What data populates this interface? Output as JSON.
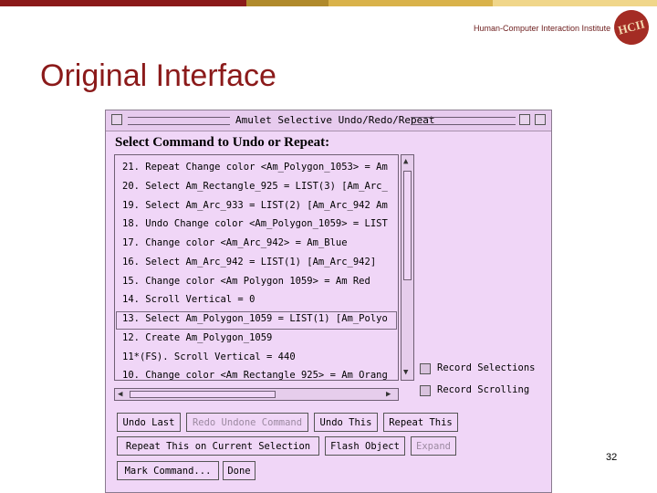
{
  "slide": {
    "title": "Original Interface",
    "institute": "Human-Computer Interaction Institute",
    "logo_text": "HCII",
    "page_number": "32",
    "top_bar_colors": [
      "#8b1a1a",
      "#b08a2c",
      "#d9b24a",
      "#f0d68a"
    ]
  },
  "window": {
    "title": "Amulet Selective Undo/Redo/Repeat",
    "heading": "Select Command to Undo or Repeat:",
    "history": [
      "21. Repeat Change color <Am_Polygon_1053> = Am",
      "20. Select Am_Rectangle_925 = LIST(3) [Am_Arc_",
      "19. Select Am_Arc_933 = LIST(2) [Am_Arc_942 Am",
      "18. Undo Change color <Am_Polygon_1059> = LIST",
      "17. Change color <Am_Arc_942> = Am_Blue",
      "16. Select Am_Arc_942 = LIST(1) [Am_Arc_942]",
      "15. Change color <Am Polygon 1059> = Am Red",
      "14. Scroll Vertical  = 0",
      "13. Select Am_Polygon_1059 = LIST(1) [Am_Polyo",
      "12. Create Am_Polygon_1059",
      "11*(FS). Scroll Vertical  = 440",
      "10. Change color <Am_Rectangle_925> = Am_Orang"
    ],
    "selected_index": 6,
    "checkboxes": [
      {
        "label": "Record Selections",
        "checked": false
      },
      {
        "label": "Record Scrolling",
        "checked": false
      }
    ],
    "buttons": {
      "undo_last": "Undo Last",
      "redo_undone": "Redo Undone Command",
      "undo_this": "Undo This",
      "repeat_this": "Repeat This",
      "repeat_on_selection": "Repeat This on Current Selection",
      "flash_object": "Flash Object",
      "expand": "Expand",
      "mark_command": "Mark Command...",
      "done": "Done"
    },
    "colors": {
      "background": "#f0d6f7"
    }
  }
}
